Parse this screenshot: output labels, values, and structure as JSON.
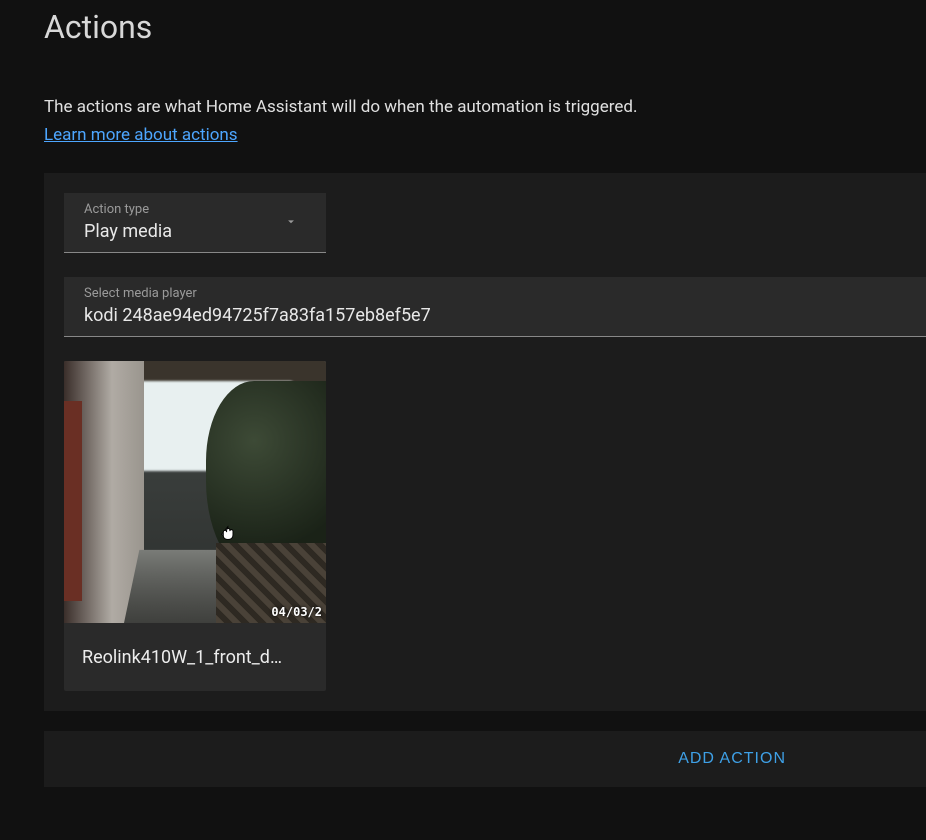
{
  "header": {
    "title": "Actions"
  },
  "intro": {
    "description": "The actions are what Home Assistant will do when the automation is triggered.",
    "learn_more": "Learn more about actions"
  },
  "action": {
    "type_label": "Action type",
    "type_value": "Play media",
    "player_label": "Select media player",
    "player_value": "kodi 248ae94ed94725f7a83fa157eb8ef5e7",
    "media": {
      "name": "Reolink410W_1_front_d…",
      "timestamp": "04/03/2"
    }
  },
  "buttons": {
    "add_action": "ADD ACTION"
  }
}
